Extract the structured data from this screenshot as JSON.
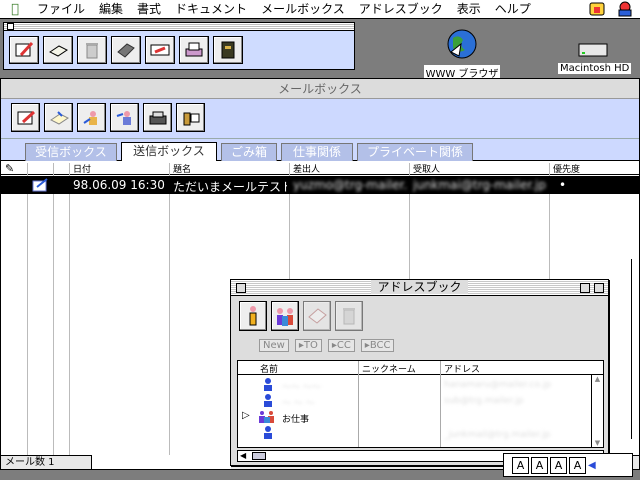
{
  "menubar": {
    "items": [
      "ファイル",
      "編集",
      "書式",
      "ドキュメント",
      "メールボックス",
      "アドレスブック",
      "表示",
      "ヘルプ"
    ]
  },
  "desktop": {
    "icons": [
      {
        "label": "WWW ブラウザ",
        "icon": "globe-icon"
      },
      {
        "label": "Macintosh HD",
        "icon": "hard-disk-icon"
      }
    ]
  },
  "palette": {
    "tools": [
      "compose-icon",
      "document-icon",
      "trash-icon",
      "tag-icon",
      "send-icon",
      "print-icon",
      "notebook-icon"
    ]
  },
  "mailbox": {
    "title": "メールボックス",
    "toolbar": [
      "compose-icon",
      "reply-icon",
      "reply-all-icon",
      "forward-icon",
      "print-icon",
      "attach-icon"
    ],
    "tabs": [
      {
        "label": "受信ボックス",
        "active": false
      },
      {
        "label": "送信ボックス",
        "active": true
      },
      {
        "label": "ごみ箱",
        "active": false
      },
      {
        "label": "仕事関係",
        "active": false
      },
      {
        "label": "プライベート関係",
        "active": false
      }
    ],
    "columns": [
      "日付",
      "題名",
      "差出人",
      "受取人",
      "優先度"
    ],
    "messages": [
      {
        "date": "98.06.09 16:30",
        "subject": "ただいまメールテスト",
        "from": "yuzmo@trg-mailer.jp",
        "to": "junkmai@trg-mailer.jp",
        "priority": "•"
      }
    ],
    "status": "メール数  1"
  },
  "addressbook": {
    "title": "アドレスブック",
    "buttons": [
      "New",
      "▸TO",
      "▸CC",
      "▸BCC"
    ],
    "columns": [
      "名前",
      "ニックネーム",
      "アドレス"
    ],
    "rows": [
      {
        "name": "〜〜 〜〜",
        "nickname": "",
        "address": "hanamaru@mailer.co.jp",
        "group": false,
        "blurred": true
      },
      {
        "name": "〜 〜 〜",
        "nickname": "",
        "address": "sub@trg.mailer.jp",
        "group": false,
        "blurred": true
      },
      {
        "name": "お仕事",
        "nickname": "",
        "address": "",
        "group": true,
        "blurred": false
      },
      {
        "name": "",
        "nickname": "",
        "address": "_junkmail@trg.mailer.jp",
        "group": false,
        "blurred": true
      }
    ]
  },
  "control_strip": [
    "A",
    "A",
    "A",
    "A"
  ],
  "colors": {
    "toolbar_bg": "#cdd9ff",
    "tab_inactive": "#b3c0e8",
    "selected_row": "#000000",
    "desktop": "#7d7d7d"
  }
}
